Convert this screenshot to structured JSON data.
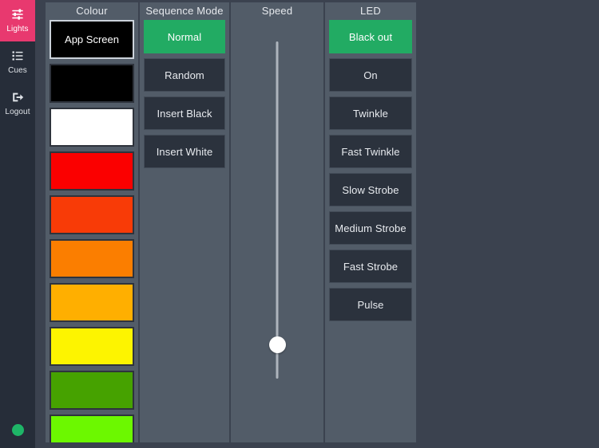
{
  "sidebar": {
    "items": [
      {
        "label": "Lights",
        "icon": "sliders-icon",
        "active": true
      },
      {
        "label": "Cues",
        "icon": "list-icon",
        "active": false
      },
      {
        "label": "Logout",
        "icon": "logout-icon",
        "active": false
      }
    ],
    "status_dot_color": "#1eb567",
    "active_color": "#e8396f"
  },
  "columns": {
    "colour": {
      "title": "Colour",
      "swatches": [
        {
          "label": "App Screen",
          "color": "#000000",
          "selected": true
        },
        {
          "label": "",
          "color": "#000000",
          "selected": false
        },
        {
          "label": "",
          "color": "#ffffff",
          "selected": false
        },
        {
          "label": "",
          "color": "#fb0000",
          "selected": false
        },
        {
          "label": "",
          "color": "#f83b07",
          "selected": false
        },
        {
          "label": "",
          "color": "#fb7e00",
          "selected": false
        },
        {
          "label": "",
          "color": "#ffaf00",
          "selected": false
        },
        {
          "label": "",
          "color": "#fdf400",
          "selected": false
        },
        {
          "label": "",
          "color": "#46a200",
          "selected": false
        },
        {
          "label": "",
          "color": "#6cf800",
          "selected": false
        }
      ]
    },
    "sequence": {
      "title": "Sequence Mode",
      "options": [
        {
          "label": "Normal",
          "selected": true
        },
        {
          "label": "Random",
          "selected": false
        },
        {
          "label": "Insert Black",
          "selected": false
        },
        {
          "label": "Insert White",
          "selected": false
        }
      ]
    },
    "speed": {
      "title": "Speed",
      "value_percent": 10,
      "orientation": "vertical"
    },
    "led": {
      "title": "LED",
      "options": [
        {
          "label": "Black out",
          "selected": true
        },
        {
          "label": "On",
          "selected": false
        },
        {
          "label": "Twinkle",
          "selected": false
        },
        {
          "label": "Fast Twinkle",
          "selected": false
        },
        {
          "label": "Slow Strobe",
          "selected": false
        },
        {
          "label": "Medium Strobe",
          "selected": false
        },
        {
          "label": "Fast Strobe",
          "selected": false
        },
        {
          "label": "Pulse",
          "selected": false
        }
      ]
    }
  },
  "theme": {
    "page_background": "#3b424f",
    "panel_background": "#525c68",
    "button_background": "#2b323d",
    "selected_green": "#22ab63",
    "sidebar_background": "#262d39"
  }
}
